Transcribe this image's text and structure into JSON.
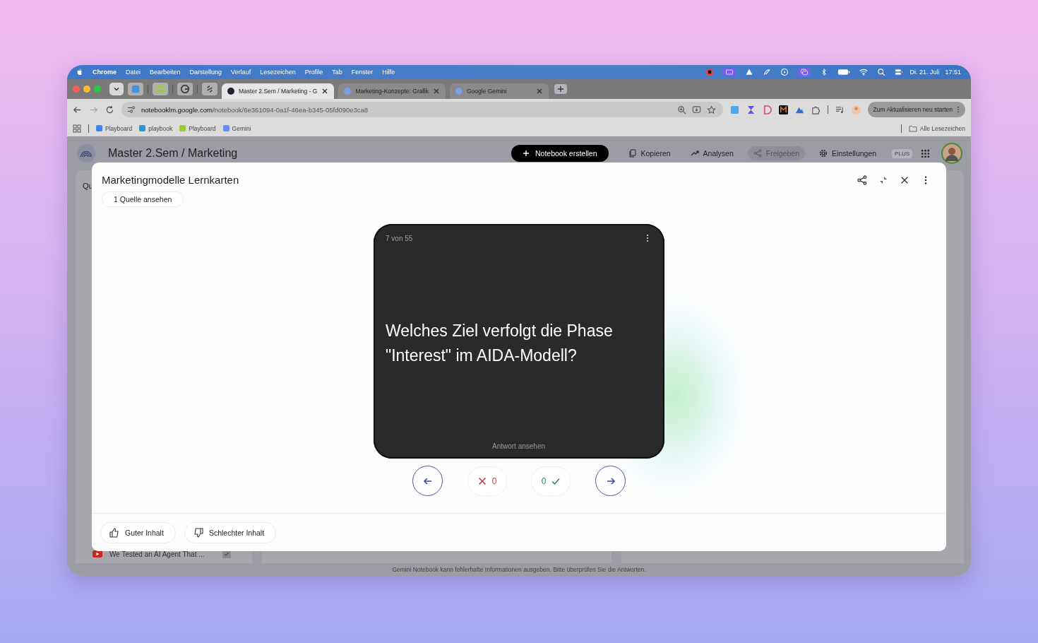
{
  "menubar": {
    "app": "Chrome",
    "menus": [
      "Datei",
      "Bearbeiten",
      "Darstellung",
      "Verlauf",
      "Lesezeichen",
      "Profile",
      "Tab",
      "Fenster",
      "Hilfe"
    ],
    "date": "Di. 21. Juli",
    "time": "17:51"
  },
  "browser": {
    "tabs": [
      {
        "title": "Master 2.Sem / Marketing - G",
        "selected": true
      },
      {
        "title": "Marketing-Konzepte: Grafik",
        "selected": false
      },
      {
        "title": "Google Gemini",
        "selected": false
      }
    ],
    "address_host": "notebooklm.google.com",
    "address_path": "/notebook/6e361094-0a1f-46ea-b345-05fd090e3ca8",
    "update_button": "Zum Aktualisieren neu starten",
    "bookmarks": [
      "Playboard",
      "playbook",
      "Playboard",
      "Gemini"
    ],
    "all_bookmarks": "Alle Lesezeichen"
  },
  "app": {
    "title": "Master 2.Sem / Marketing",
    "create_button": "Notebook erstellen",
    "actions": [
      {
        "label": "Kopieren",
        "disabled": false
      },
      {
        "label": "Analysen",
        "disabled": false
      },
      {
        "label": "Freigeben",
        "disabled": true
      }
    ],
    "settings": "Einstellungen",
    "plan_badge": "PLUS"
  },
  "background": {
    "panel_label": "Qu",
    "source_item": "We Tested an AI Agent That ...",
    "disclaimer": "Gemini Notebook kann fehlerhafte Informationen ausgeben. Bitte überprüfen Sie die Antworten."
  },
  "modal": {
    "title": "Marketingmodelle Lernkarten",
    "source_button": "1 Quelle ansehen",
    "card": {
      "counter": "7 von 55",
      "question": "Welches Ziel verfolgt die Phase \"Interest\" im AIDA-Modell?",
      "reveal": "Antwort ansehen"
    },
    "wrong_count": "0",
    "right_count": "0",
    "feedback": [
      "Guter Inhalt",
      "Schlechter Inhalt"
    ]
  }
}
